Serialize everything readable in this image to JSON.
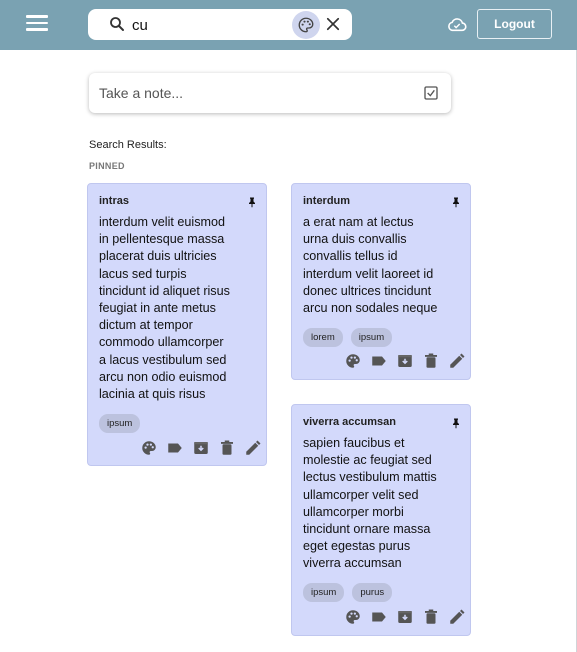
{
  "header": {
    "search_value": "cu",
    "logout_label": "Logout",
    "icons": {
      "menu": "hamburger-menu-icon",
      "search": "search-icon",
      "palette": "palette-icon",
      "clear": "close-icon",
      "cloud": "cloud-sync-icon"
    },
    "colors": {
      "bar": "#7aa2b2"
    }
  },
  "take_note": {
    "placeholder": "Take a note..."
  },
  "results_label": "Search Results:",
  "pinned_label": "PINNED",
  "notes": [
    {
      "title": "intras",
      "body": "interdum velit euismod\nin pellentesque massa\nplacerat duis ultricies\nlacus sed turpis\ntincidunt id aliquet risus\nfeugiat in ante metus\ndictum at tempor\ncommodo ullamcorper\na lacus vestibulum sed\narcu non odio euismod\nlacinia at quis risus",
      "labels": [
        "ipsum"
      ],
      "pinned": true
    },
    {
      "title": "interdum",
      "body": "a erat nam at lectus\nurna duis convallis\nconvallis tellus id\ninterdum velit laoreet id\ndonec ultrices tincidunt\narcu non sodales neque",
      "labels": [
        "lorem",
        "ipsum"
      ],
      "pinned": true
    },
    {
      "title": "viverra accumsan",
      "body": "sapien faucibus et\nmolestie ac feugiat sed\nlectus vestibulum mattis\nullamcorper velit sed\nullamcorper morbi\ntincidunt ornare massa\neget egestas purus\nviverra accumsan",
      "labels": [
        "ipsum",
        "purus"
      ],
      "pinned": true
    }
  ],
  "note_colors": {
    "background": "#d3d9fb",
    "chip": "#bcc2de"
  }
}
